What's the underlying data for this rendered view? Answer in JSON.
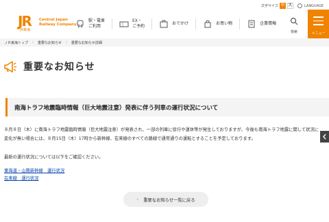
{
  "header": {
    "logo_mark": "JR",
    "logo_sub": "JR東海",
    "logo_line1": "Central Japan",
    "logo_line2": "Railway Company",
    "text_size_label": "文字サイズ",
    "text_size_medium": "中",
    "text_size_large": "大",
    "language_label": "LANGUAGE",
    "nav": [
      {
        "label": "駅・電車\nご利用",
        "icon": "train-icon"
      },
      {
        "label": "EX・\nご予約",
        "icon": "ticket-icon"
      },
      {
        "label": "おでかけ",
        "icon": "suitcase-icon"
      },
      {
        "label": "お買い物",
        "icon": "shopping-bag-icon"
      },
      {
        "label": "企業情報",
        "icon": "building-icon"
      }
    ],
    "search_label": "検索",
    "menu_label": "メニュー"
  },
  "breadcrumb": [
    "ＪＲ東海トップ",
    "重要なお知らせ",
    "重要なお知らせ詳細"
  ],
  "page_title": "重要なお知らせ",
  "notice_title": "南海トラフ地震臨時情報（巨大地震注意）発表に伴う列車の運行状況について",
  "body": {
    "paragraph1": "８月８日（木）に南海トラフ地震臨時情報（巨大地震注意）が発表され、一部の列車に徐行や運休等が発生しておりますが、今後も南海トラフ地震に関して状況に変化が無い場合には、８月15日（木）17時から新幹線、在来線のすべての路線で通常通りの運転とすることを予定しております。",
    "paragraph2": "最新の運行状況については以下をご確認ください。",
    "link1": "東海道・山陽新幹線　運行状況",
    "link2": "在来線　運行状況"
  },
  "back_button_label": "重要なお知らせ一覧に戻る",
  "colors": {
    "accent": "#f08300",
    "link": "#0645ad"
  }
}
